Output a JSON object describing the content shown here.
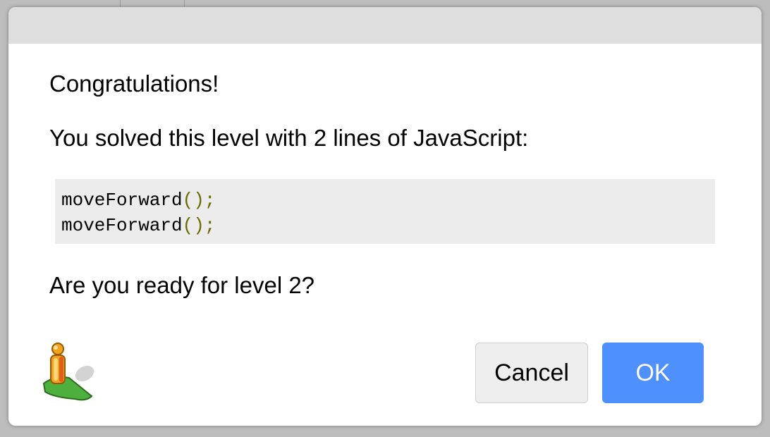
{
  "dialog": {
    "heading": "Congratulations!",
    "summary": "You solved this level with 2 lines of JavaScript:",
    "code_lines": [
      {
        "name": "moveForward",
        "parens": "()",
        "semicolon": ";"
      },
      {
        "name": "moveForward",
        "parens": "()",
        "semicolon": ";"
      }
    ],
    "question": "Are you ready for level 2?",
    "icon": "pegman-icon",
    "buttons": {
      "cancel_label": "Cancel",
      "ok_label": "OK"
    }
  },
  "colors": {
    "ok_button": "#4d90fe",
    "titlebar": "#dedede",
    "code_background": "#ececec",
    "code_paren": "#6b6b00"
  }
}
